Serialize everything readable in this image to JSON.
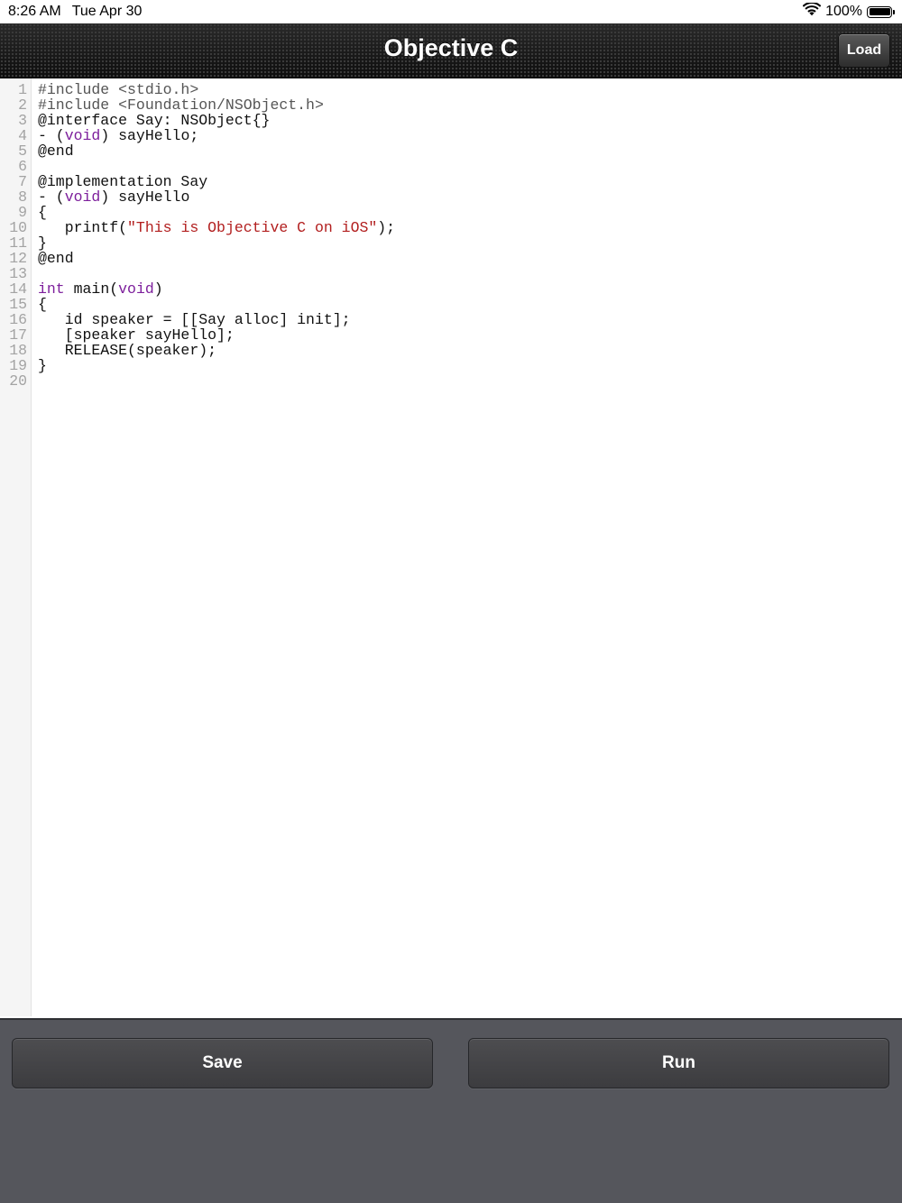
{
  "status_bar": {
    "time": "8:26 AM",
    "date": "Tue Apr 30",
    "battery": "100%",
    "battery_level": 1.0
  },
  "nav": {
    "title": "Objective C",
    "load_label": "Load"
  },
  "editor": {
    "lines": [
      {
        "num": "1",
        "tokens": [
          {
            "t": "#include <stdio.h>",
            "c": "pre"
          }
        ]
      },
      {
        "num": "2",
        "tokens": [
          {
            "t": "#include <Foundation/NSObject.h>",
            "c": "pre"
          }
        ]
      },
      {
        "num": "3",
        "tokens": [
          {
            "t": "@interface Say: NSObject{}",
            "c": ""
          }
        ]
      },
      {
        "num": "4",
        "tokens": [
          {
            "t": "- (",
            "c": ""
          },
          {
            "t": "void",
            "c": "kw"
          },
          {
            "t": ") sayHello;",
            "c": ""
          }
        ]
      },
      {
        "num": "5",
        "tokens": [
          {
            "t": "@end",
            "c": ""
          }
        ]
      },
      {
        "num": "6",
        "tokens": []
      },
      {
        "num": "7",
        "tokens": [
          {
            "t": "@implementation Say",
            "c": ""
          }
        ]
      },
      {
        "num": "8",
        "tokens": [
          {
            "t": "- (",
            "c": ""
          },
          {
            "t": "void",
            "c": "kw"
          },
          {
            "t": ") sayHello",
            "c": ""
          }
        ]
      },
      {
        "num": "9",
        "tokens": [
          {
            "t": "{",
            "c": ""
          }
        ]
      },
      {
        "num": "10",
        "tokens": [
          {
            "t": "   printf(",
            "c": ""
          },
          {
            "t": "\"This is Objective C on iOS\"",
            "c": "str"
          },
          {
            "t": ");",
            "c": ""
          }
        ]
      },
      {
        "num": "11",
        "tokens": [
          {
            "t": "}",
            "c": ""
          }
        ]
      },
      {
        "num": "12",
        "tokens": [
          {
            "t": "@end",
            "c": ""
          }
        ]
      },
      {
        "num": "13",
        "tokens": []
      },
      {
        "num": "14",
        "tokens": [
          {
            "t": "int",
            "c": "kw"
          },
          {
            "t": " main(",
            "c": ""
          },
          {
            "t": "void",
            "c": "kw"
          },
          {
            "t": ")",
            "c": ""
          }
        ]
      },
      {
        "num": "15",
        "tokens": [
          {
            "t": "{",
            "c": ""
          }
        ]
      },
      {
        "num": "16",
        "tokens": [
          {
            "t": "   id speaker = [[Say alloc] init];",
            "c": ""
          }
        ]
      },
      {
        "num": "17",
        "tokens": [
          {
            "t": "   [speaker sayHello];",
            "c": ""
          }
        ]
      },
      {
        "num": "18",
        "tokens": [
          {
            "t": "   RELEASE(speaker);",
            "c": ""
          }
        ]
      },
      {
        "num": "19",
        "tokens": [
          {
            "t": "}",
            "c": ""
          }
        ]
      },
      {
        "num": "20",
        "tokens": []
      }
    ]
  },
  "toolbar": {
    "save_label": "Save",
    "run_label": "Run"
  },
  "colors": {
    "keyword": "#7d1f9c",
    "string": "#b21e1e",
    "preprocessor": "#555555",
    "bottom_bar": "#55565c"
  },
  "icons": {
    "wifi": "wifi-icon",
    "battery": "battery-icon"
  }
}
